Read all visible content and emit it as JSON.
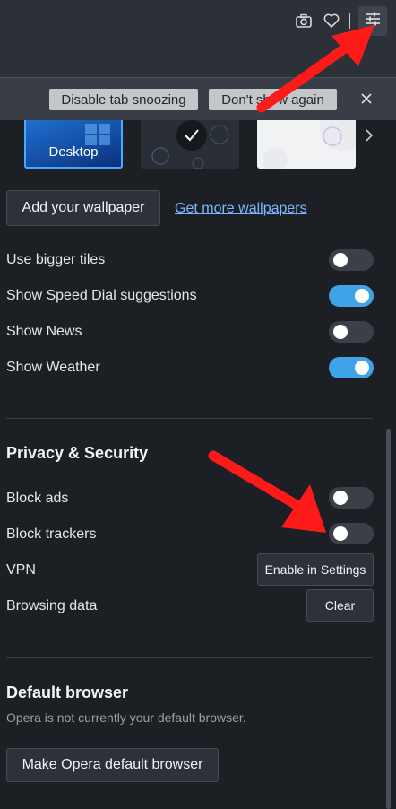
{
  "toolbar": {
    "icons": [
      "camera-icon",
      "heart-icon",
      "easy-setup-icon"
    ]
  },
  "notification": {
    "disable_label": "Disable tab snoozing",
    "dont_show_label": "Don't show again",
    "close_icon": "close-icon"
  },
  "wallpapers": {
    "items": [
      {
        "label": "Desktop",
        "selected": false
      },
      {
        "label": "",
        "selected": true
      },
      {
        "label": "",
        "selected": false
      }
    ],
    "next_icon": "chevron-right-icon",
    "add_label": "Add your wallpaper",
    "more_link": "Get more wallpapers"
  },
  "settings": {
    "bigger_tiles": {
      "label": "Use bigger tiles",
      "on": false
    },
    "speed_dial": {
      "label": "Show Speed Dial suggestions",
      "on": true
    },
    "news": {
      "label": "Show News",
      "on": false
    },
    "weather": {
      "label": "Show Weather",
      "on": true
    }
  },
  "privacy": {
    "title": "Privacy & Security",
    "block_ads": {
      "label": "Block ads",
      "on": false
    },
    "block_trackers": {
      "label": "Block trackers",
      "on": false
    },
    "vpn": {
      "label": "VPN",
      "button": "Enable in Settings"
    },
    "browsing_data": {
      "label": "Browsing data",
      "button": "Clear"
    }
  },
  "default_browser": {
    "title": "Default browser",
    "subtitle": "Opera is not currently your default browser.",
    "button": "Make Opera default browser"
  },
  "colors": {
    "accent": "#3fa3e8",
    "annotation_arrow": "#ff1a1a"
  }
}
